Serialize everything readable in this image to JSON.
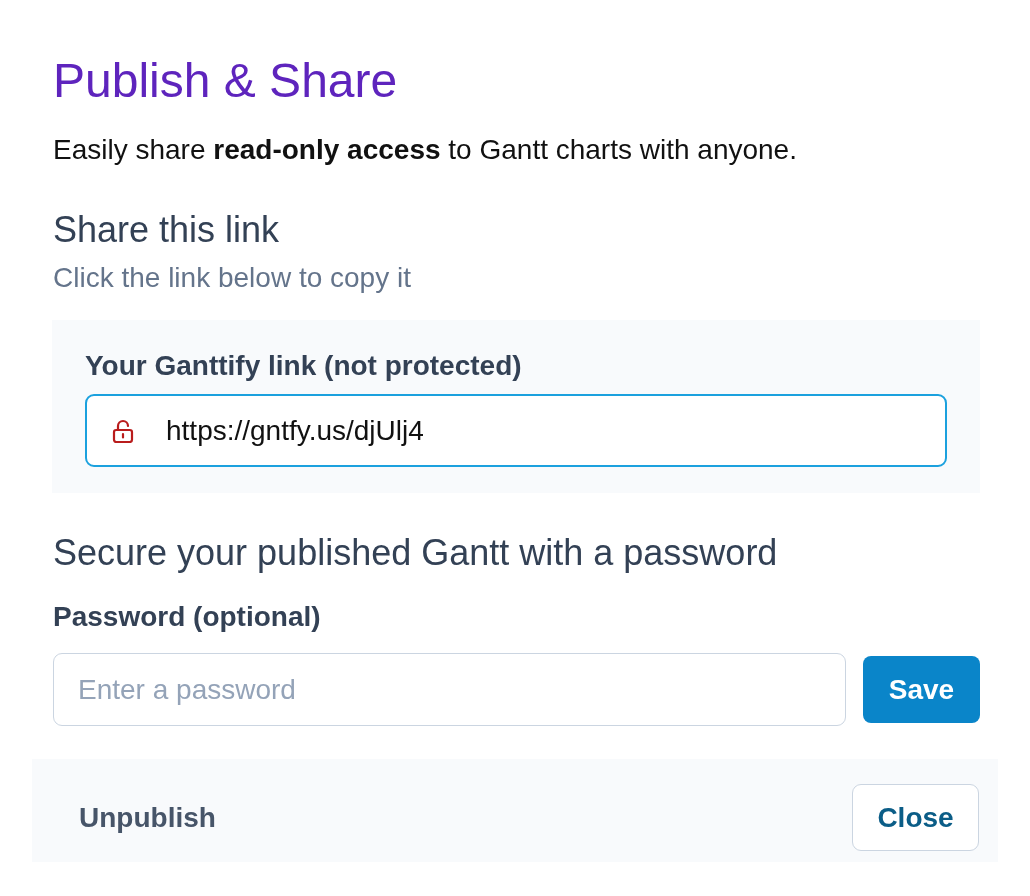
{
  "dialog": {
    "title": "Publish & Share",
    "description": "Easily share **read-only access** to Gantt charts with anyone."
  },
  "share_link": {
    "heading": "Share this link",
    "hint": "Click the link below to copy it",
    "label": "Your Ganttify link (not protected)",
    "protected": false,
    "url": "https://gntfy.us/djUlj4"
  },
  "password": {
    "heading": "Secure your published Gantt with a password",
    "label": "Password (optional)",
    "placeholder": "Enter a password",
    "button": "Save"
  },
  "footer": {
    "unpublish": "Unpublish",
    "close": "Close"
  }
}
